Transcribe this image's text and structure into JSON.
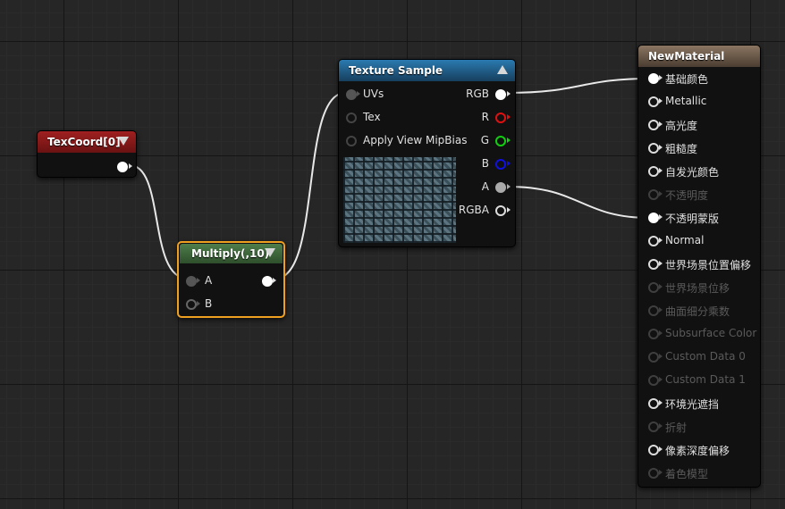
{
  "nodes": {
    "texcoord": {
      "title": "TexCoord[0]",
      "title_color": "#8a1a1a"
    },
    "multiply": {
      "title": "Multiply(,10)",
      "title_color": "#3d6b3a",
      "inputs": [
        "A",
        "B"
      ]
    },
    "texture": {
      "title": "Texture Sample",
      "title_color": "#1c5a86",
      "inputs": [
        "UVs",
        "Tex",
        "Apply View MipBias"
      ],
      "outputs": [
        "RGB",
        "R",
        "G",
        "B",
        "A",
        "RGBA"
      ]
    },
    "material": {
      "title": "NewMaterial",
      "title_color": "#6b5a48",
      "inputs": [
        {
          "label": "基础颜色",
          "state": "connected"
        },
        {
          "label": "Metallic",
          "state": "active"
        },
        {
          "label": "高光度",
          "state": "active"
        },
        {
          "label": "粗糙度",
          "state": "active"
        },
        {
          "label": "自发光颜色",
          "state": "active"
        },
        {
          "label": "不透明度",
          "state": "disabled"
        },
        {
          "label": "不透明蒙版",
          "state": "connected"
        },
        {
          "label": "Normal",
          "state": "active"
        },
        {
          "label": "世界场景位置偏移",
          "state": "active"
        },
        {
          "label": "世界场景位移",
          "state": "disabled"
        },
        {
          "label": "曲面细分乘数",
          "state": "disabled"
        },
        {
          "label": "Subsurface Color",
          "state": "disabled"
        },
        {
          "label": "Custom Data 0",
          "state": "disabled"
        },
        {
          "label": "Custom Data 1",
          "state": "disabled"
        },
        {
          "label": "环境光遮挡",
          "state": "active"
        },
        {
          "label": "折射",
          "state": "disabled"
        },
        {
          "label": "像素深度偏移",
          "state": "active"
        },
        {
          "label": "着色模型",
          "state": "disabled"
        }
      ]
    }
  },
  "colors": {
    "pin_r": "#e01010",
    "pin_g": "#10d010",
    "pin_b": "#1010e0",
    "selection": "#f0a020"
  }
}
